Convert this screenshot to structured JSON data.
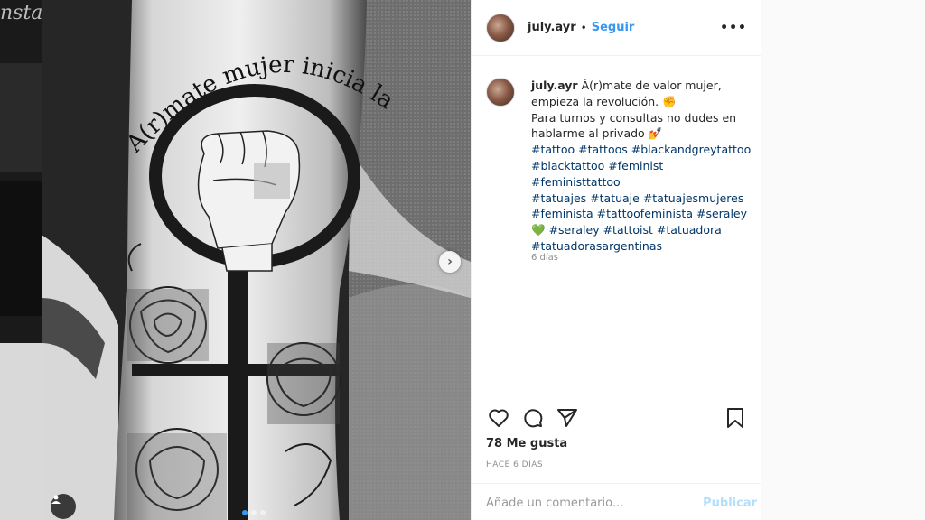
{
  "left_strip": {
    "bg_text": "nsta"
  },
  "photo": {
    "tattoo_text": "A(r)mate mujer inicia la revolu"
  },
  "header": {
    "username": "july.ayr",
    "separator": "•",
    "follow_label": "Seguir",
    "more_label": "•••"
  },
  "caption": {
    "username": "july.ayr",
    "lines": [
      "Á(r)mate de valor mujer,",
      "empieza la revolución. ✊",
      "Para turnos y consultas no dudes en",
      "hablarme al privado 💅"
    ],
    "hashtag_lines": [
      "#tattoo #tattoos #blackandgreytattoo",
      "#blacktattoo #feminist #feministtattoo",
      "#tatuajes #tatuaje #tatuajesmujeres",
      "#feminista #tattoofeminista #seraley",
      "#seraley #tattoist #tatuadora",
      "#tatuadorasargentinas"
    ],
    "heart_emoji": "💚",
    "time": "6 días"
  },
  "actions": {
    "likes": "78 Me gusta",
    "ago": "HACE 6 DÍAS"
  },
  "comment": {
    "placeholder": "Añade un comentario...",
    "publish_label": "Publicar"
  },
  "colors": {
    "accent": "#3897f0",
    "hashtag": "#003569",
    "publish_disabled": "#b2dffc"
  }
}
